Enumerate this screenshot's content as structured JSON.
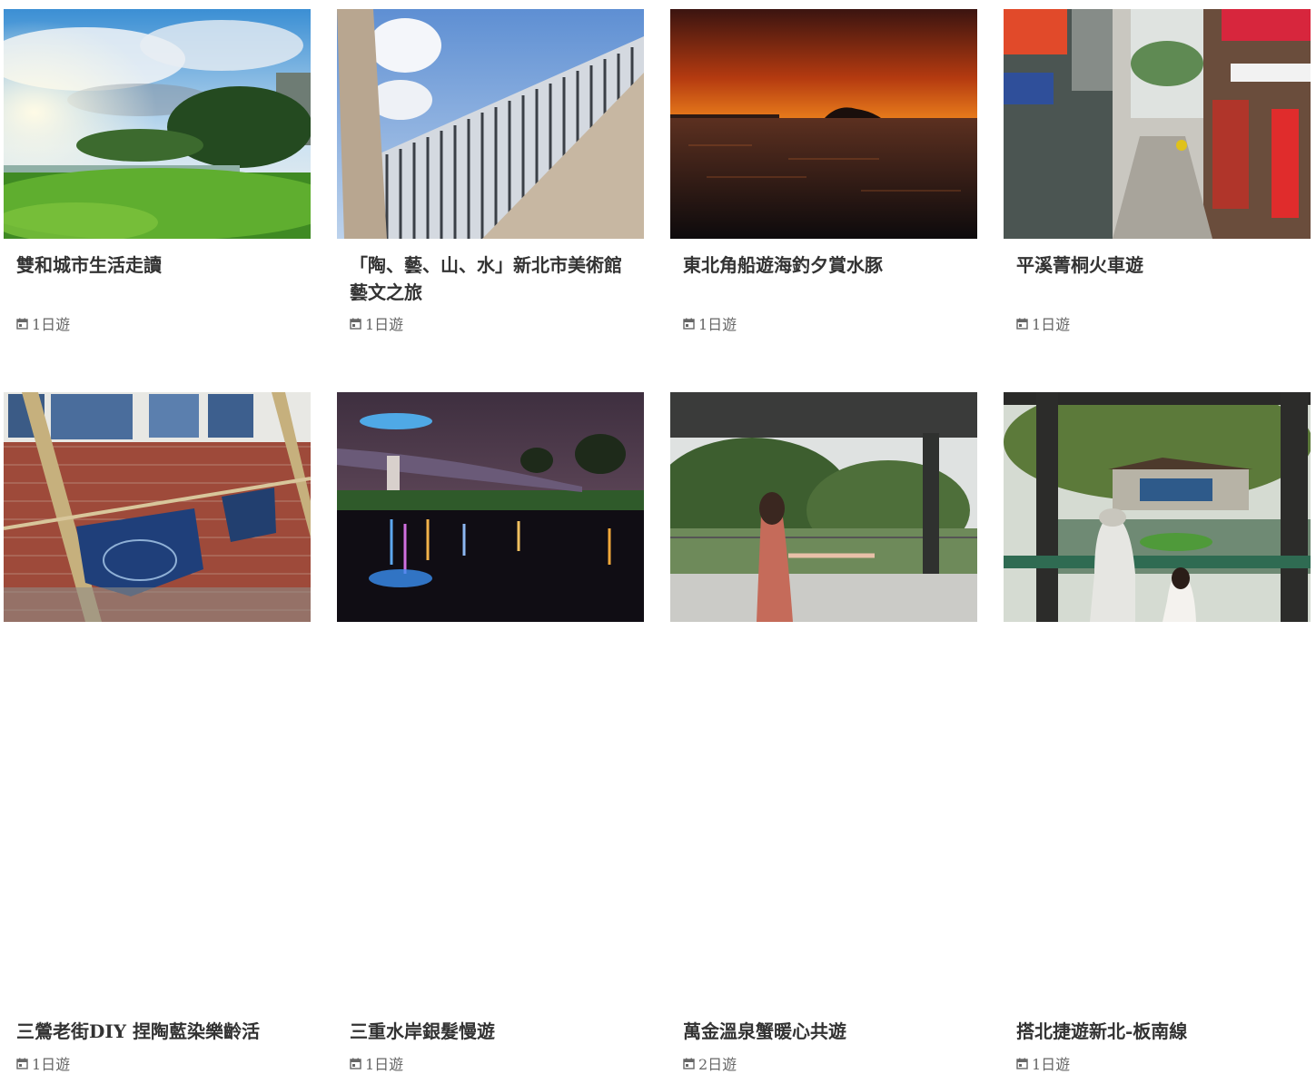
{
  "trips": [
    {
      "title": "雙和城市生活走讀",
      "duration": "1日遊",
      "image": "park-lawn-city-skyline"
    },
    {
      "title": "「陶、藝、山、水」新北市美術館藝文之旅",
      "duration": "1日遊",
      "image": "art-museum-facade"
    },
    {
      "title": "東北角船遊海釣夕賞水豚",
      "duration": "1日遊",
      "image": "sunset-sea-island"
    },
    {
      "title": "平溪菁桐火車遊",
      "duration": "1日遊",
      "image": "old-street-shops"
    },
    {
      "title": "三鶯老街DIY 捏陶藍染樂齡活",
      "duration": "1日遊",
      "image": "indigo-dye-brick-wall"
    },
    {
      "title": "三重水岸銀髮慢遊",
      "duration": "1日遊",
      "image": "riverside-night-bridge"
    },
    {
      "title": "萬金溫泉蟹暖心共遊",
      "duration": "2日遊",
      "image": "hot-spring-pavilion-woman"
    },
    {
      "title": "搭北捷遊新北-板南線",
      "duration": "1日遊",
      "image": "garden-pavilion-pond"
    }
  ]
}
